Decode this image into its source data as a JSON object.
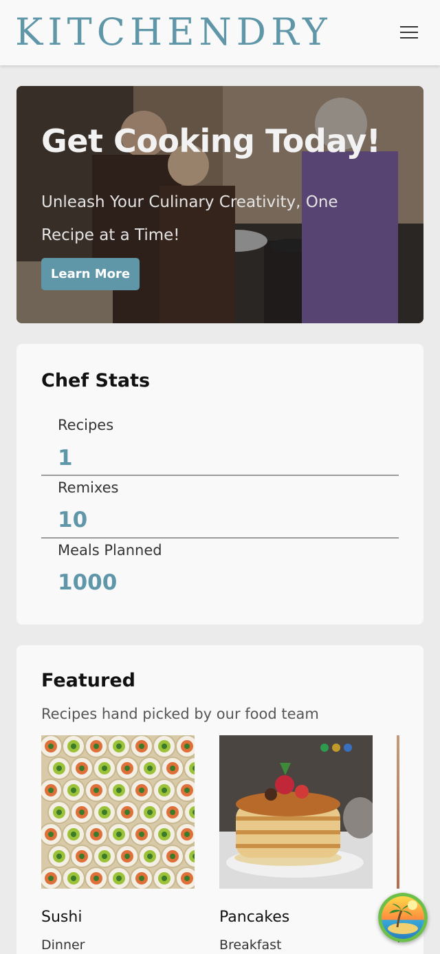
{
  "header": {
    "logo": "KITCHENDRY",
    "menu_icon": "hamburger-menu-icon"
  },
  "hero": {
    "title": "Get Cooking Today!",
    "subtitle": "Unleash Your Culinary Creativity, One Recipe at a Time!",
    "button_label": "Learn More"
  },
  "stats": {
    "title": "Chef Stats",
    "items": [
      {
        "label": "Recipes",
        "value": "1"
      },
      {
        "label": "Remixes",
        "value": "10"
      },
      {
        "label": "Meals Planned",
        "value": "1000"
      }
    ]
  },
  "featured": {
    "title": "Featured",
    "subtitle": "Recipes hand picked by our food team",
    "recipes": [
      {
        "name": "Sushi",
        "category": "Dinner",
        "dot_colors": [
          "#2e9b4e",
          "#c29a2a",
          "#3a6fc0"
        ]
      },
      {
        "name": "Pancakes",
        "category": "Breakfast",
        "dot_colors": [
          "#2e9b4e",
          "#c29a2a",
          "#3a6fc0"
        ]
      }
    ]
  },
  "colors": {
    "accent": "#5f96a8",
    "page_bg": "#ebebeb",
    "card_bg": "#f9f9f9"
  },
  "fab": {
    "icon": "tropical-island-icon"
  }
}
